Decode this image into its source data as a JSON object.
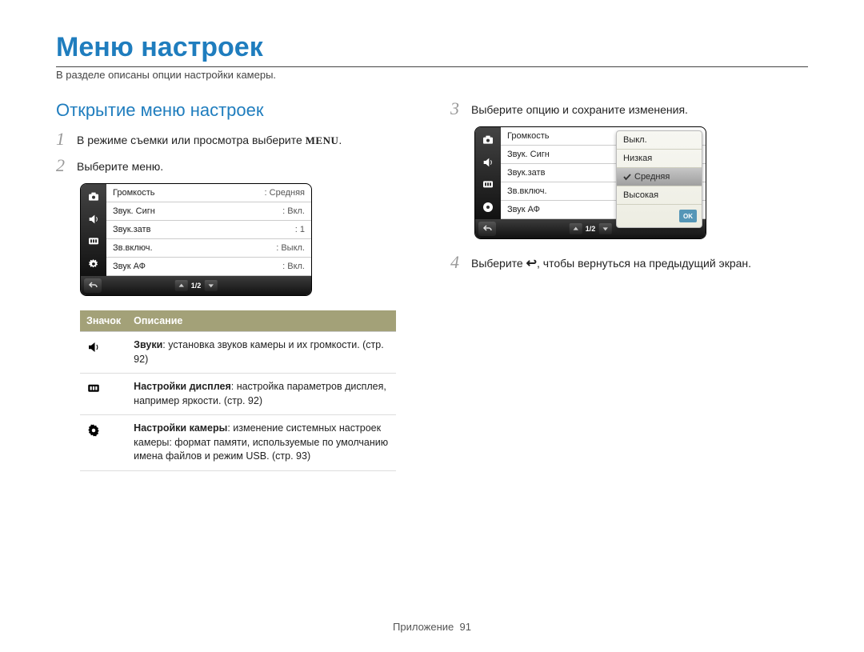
{
  "title": "Меню настроек",
  "subtitle": "В разделе описаны опции настройки камеры.",
  "section_head": "Открытие меню настроек",
  "steps": {
    "s1a": "В режиме съемки или просмотра выберите ",
    "s1_menu": "MENU",
    "s1b": ".",
    "s2": "Выберите меню.",
    "s3": "Выберите опцию и сохраните изменения.",
    "s4a": "Выберите ",
    "s4b": ", чтобы вернуться на предыдущий экран."
  },
  "screen1": {
    "rows": [
      {
        "label": "Громкость",
        "value": ": Средняя"
      },
      {
        "label": "Звук. Сигн",
        "value": ": Вкл."
      },
      {
        "label": "Звук.затв",
        "value": ": 1"
      },
      {
        "label": "Зв.включ.",
        "value": ": Выкл."
      },
      {
        "label": "Звук АФ",
        "value": ": Вкл."
      }
    ],
    "pager": "1/2"
  },
  "screen2": {
    "rows": [
      {
        "label": "Громкость"
      },
      {
        "label": "Звук. Сигн"
      },
      {
        "label": "Звук.затв"
      },
      {
        "label": "Зв.включ."
      },
      {
        "label": "Звук АФ"
      }
    ],
    "popup": [
      "Выкл.",
      "Низкая",
      "Средняя",
      "Высокая"
    ],
    "selected_index": 2,
    "ok": "OK",
    "pager": "1/2"
  },
  "table": {
    "head_icon": "Значок",
    "head_desc": "Описание",
    "rows": [
      {
        "bold": "Звуки",
        "text": ": установка звуков камеры и их громкости. (стр. 92)"
      },
      {
        "bold": "Настройки дисплея",
        "text": ": настройка параметров дисплея, например яркости. (стр. 92)"
      },
      {
        "bold": "Настройки камеры",
        "text": ": изменение системных настроек камеры: формат памяти, используемые по умолчанию имена файлов и режим USB. (стр. 93)"
      }
    ]
  },
  "footer_label": "Приложение",
  "page_number": "91"
}
